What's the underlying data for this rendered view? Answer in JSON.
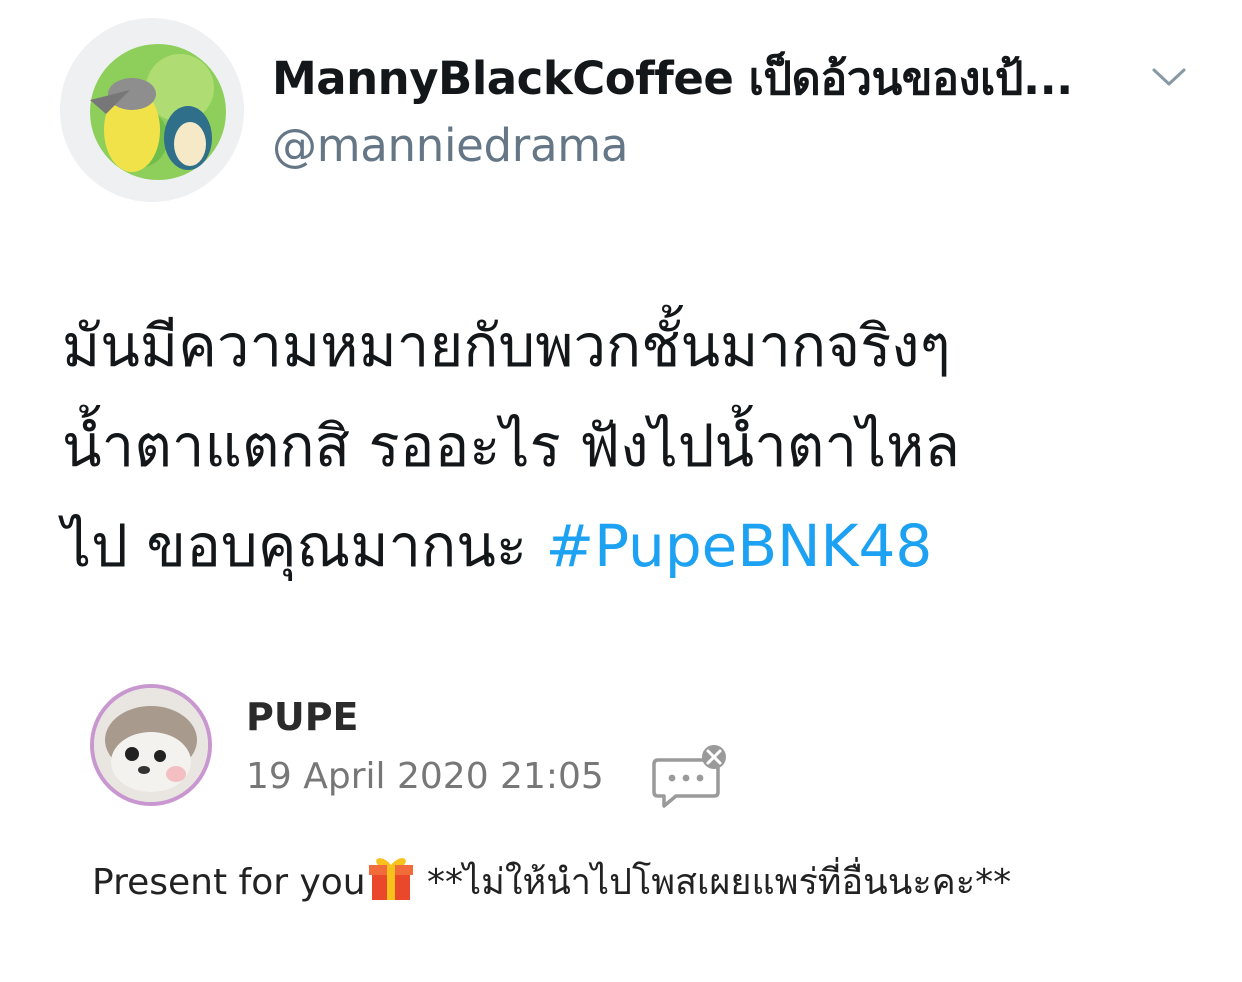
{
  "tweet": {
    "display_name": "MannyBlackCoffee เป็ดอ้วนของเป้...",
    "handle": "@manniedrama",
    "body_lines": [
      "มันมีความหมายกับพวกชั้นมากจริงๆ",
      "น้ำตาแตกสิ รออะไร ฟังไปน้ำตาไหล",
      "ไป ขอบคุณมากนะ"
    ],
    "hashtag": "#PupeBNK48"
  },
  "embed": {
    "name": "PUPE",
    "date": "19 April 2020 21:05",
    "caption_before": "Present for you",
    "caption_after": " **ไม่ให้นำไปโพสเผยแพร่ที่อื่นนะคะ**"
  },
  "icons": {
    "caret": "chevron-down-icon",
    "comment": "comment-bubble-icon",
    "gift": "gift-icon"
  },
  "colors": {
    "hashtag": "#1da1f2",
    "handle": "#657786",
    "embed_avatar_ring": "#c997cf"
  }
}
